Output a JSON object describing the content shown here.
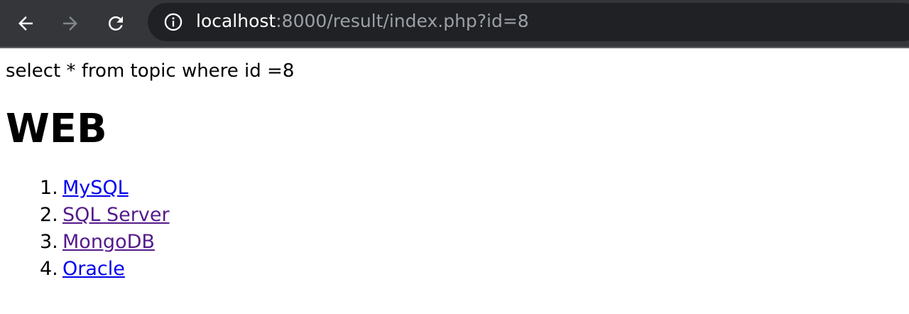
{
  "browser": {
    "url_host": "localhost",
    "url_rest": ":8000/result/index.php?id=8",
    "icons": {
      "back": "back-arrow-icon",
      "forward": "forward-arrow-icon",
      "reload": "reload-icon",
      "info": "info-icon"
    },
    "colors": {
      "toolbar": "#35363a",
      "omnibox": "#202124",
      "url_host": "#ffffff",
      "url_rest": "#9aa0a6"
    }
  },
  "page": {
    "query": "select * from topic where id =8",
    "title": "WEB",
    "links": [
      {
        "number": "1.",
        "label": "MySQL",
        "visited": false
      },
      {
        "number": "2.",
        "label": "SQL Server",
        "visited": true
      },
      {
        "number": "3.",
        "label": "MongoDB",
        "visited": true
      },
      {
        "number": "4.",
        "label": "Oracle",
        "visited": false
      }
    ],
    "colors": {
      "link": "#0000ee",
      "visited_link": "#551a8b"
    }
  }
}
